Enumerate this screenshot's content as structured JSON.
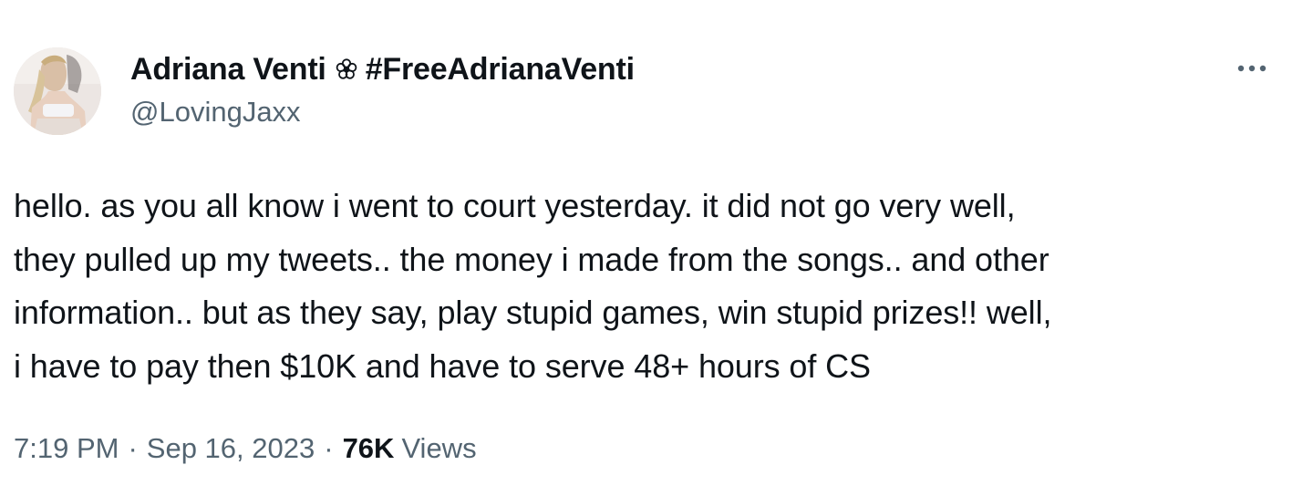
{
  "author": {
    "display_name": "Adriana Venti",
    "name_emoji_icon": "flower-icon",
    "hashtag": "#FreeAdrianaVenti",
    "handle": "@LovingJaxx",
    "avatar": "avatar-photo"
  },
  "more_icon": "more-horizontal-icon",
  "tweet": {
    "lines": [
      "hello. as you all know i went to court yesterday. it did not go very well,",
      "they pulled up my tweets.. the money i made from the songs.. and other",
      "information.. but as they say, play stupid games, win stupid prizes!! well,",
      "i have to pay then $10K and have to serve 48+ hours of CS"
    ]
  },
  "meta": {
    "time": "7:19 PM",
    "separator": "·",
    "date": "Sep 16, 2023",
    "views_count": "76K",
    "views_label": "Views"
  },
  "colors": {
    "text_primary": "#0f1419",
    "text_secondary": "#536471",
    "background": "#ffffff"
  }
}
